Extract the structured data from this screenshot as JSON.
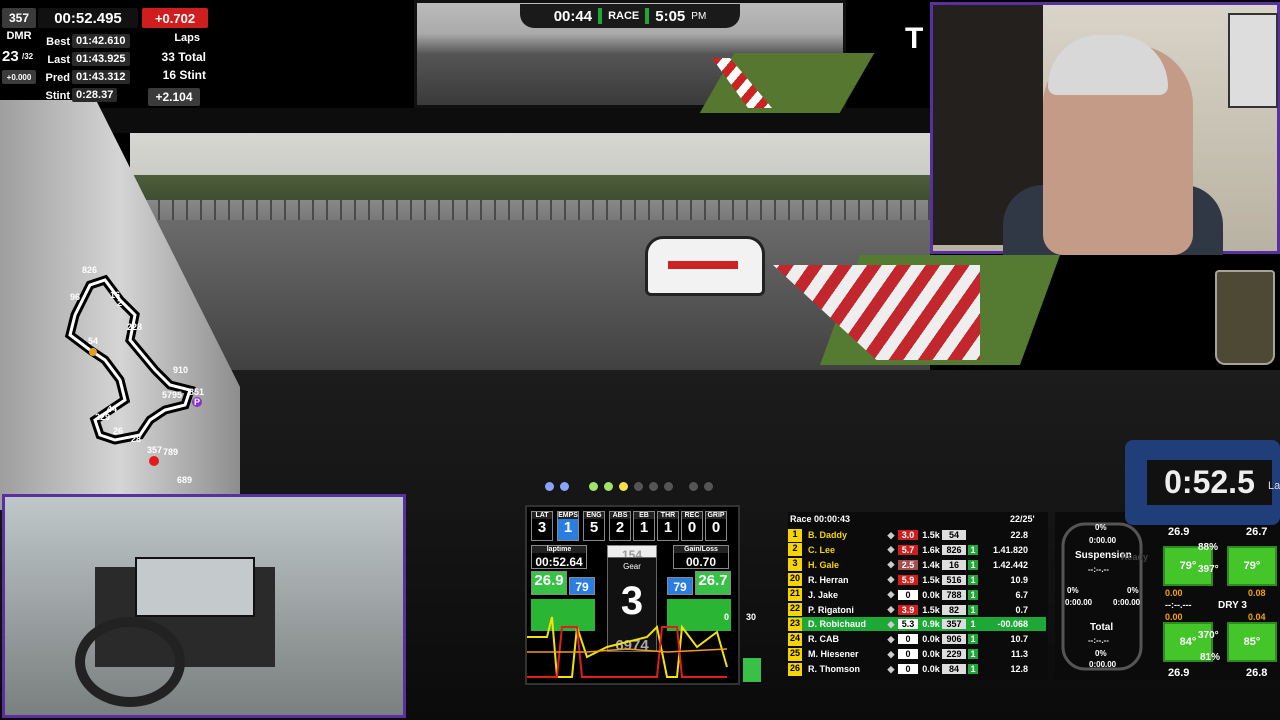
{
  "hud_timing": {
    "incident_count": "357",
    "session_time": "00:52.495",
    "delta": "+0.702",
    "dmr_label": "DMR",
    "position": "23",
    "position_total": "/32",
    "position_delta": "+0.000",
    "best_label": "Best",
    "best_value": "01:42.610",
    "last_label": "Last",
    "last_value": "01:43.925",
    "pred_label": "Pred",
    "pred_value": "01:43.312",
    "stint_label": "Stint",
    "stint_value": "0:28.37",
    "laps_label": "Laps",
    "laps_total": "33 Total",
    "laps_stint": "16 Stint",
    "stint_delta": "+2.104"
  },
  "race_bar": {
    "remaining": "00:44",
    "session": "RACE",
    "clock": "5:05",
    "ampm": "PM"
  },
  "corner_letter": "T",
  "track_map": {
    "labels": [
      "826",
      "96",
      "16",
      "2",
      "228",
      "54",
      "910",
      "851",
      "5795",
      "P",
      "229",
      "44",
      "26",
      "28",
      "357",
      "789",
      "689"
    ],
    "colors": {
      "player": "#e21b1b",
      "pit": "#8b32c9",
      "marker": "#e0a020"
    }
  },
  "dash_display": {
    "cells": [
      {
        "label": "LAT",
        "value": "3"
      },
      {
        "label": "EMPS",
        "value": "1"
      },
      {
        "label": "ENG",
        "value": "5"
      },
      {
        "label": "ABS",
        "value": "2"
      },
      {
        "label": "EB",
        "value": "1"
      },
      {
        "label": "THR",
        "value": "1"
      },
      {
        "label": "REC",
        "value": "0"
      },
      {
        "label": "GRIP",
        "value": "0"
      }
    ],
    "laptime_label": "laptime",
    "laptime": "00:52.64",
    "gain_label": "Gain/Loss",
    "gain": "00.70",
    "speed": "154",
    "gear_label": "Gear",
    "gear": "3",
    "temp_l": "26.9",
    "temp_l2": "79",
    "temp_r": "79",
    "temp_r2": "26.7",
    "rpm": "6974",
    "bar_top_l": "0",
    "bar_top_r": "30"
  },
  "leaderboard": {
    "header": "Race 00:00:43",
    "lap_info": "22/25'",
    "rows": [
      {
        "pos": "1",
        "name": "B. Daddy",
        "ir": "3.0",
        "lic": "1.5k",
        "num": "54",
        "st": "",
        "gap": "22.8",
        "gold": true
      },
      {
        "pos": "2",
        "name": "C. Lee",
        "ir": "5.7",
        "lic": "1.6k",
        "num": "826",
        "st": "1",
        "gap": "1.41.820",
        "gold": true
      },
      {
        "pos": "3",
        "name": "H. Gale",
        "ir": "2.5",
        "lic": "1.4k",
        "num": "16",
        "st": "1",
        "gap": "1.42.442",
        "gold": true
      },
      {
        "pos": "20",
        "name": "R. Herran",
        "ir": "5.9",
        "lic": "1.5k",
        "num": "516",
        "st": "1",
        "gap": "10.9",
        "gold": false
      },
      {
        "pos": "21",
        "name": "J. Jake",
        "ir": "0",
        "lic": "0.0k",
        "num": "788",
        "st": "1",
        "gap": "6.7",
        "gold": false
      },
      {
        "pos": "22",
        "name": "P. Rigatoni",
        "ir": "3.9",
        "lic": "1.5k",
        "num": "82",
        "st": "1",
        "gap": "0.7",
        "gold": false
      },
      {
        "pos": "23",
        "name": "D. Robichaud",
        "ir": "5.3",
        "lic": "0.9k",
        "num": "357",
        "st": "1",
        "gap": "-00.068",
        "gold": false,
        "me": true
      },
      {
        "pos": "24",
        "name": "R. CAB",
        "ir": "0",
        "lic": "0.0k",
        "num": "906",
        "st": "1",
        "gap": "10.7",
        "gold": false
      },
      {
        "pos": "25",
        "name": "M. Hiesener",
        "ir": "0",
        "lic": "0.0k",
        "num": "229",
        "st": "1",
        "gap": "11.3",
        "gold": false
      },
      {
        "pos": "26",
        "name": "R. Thomson",
        "ir": "0",
        "lic": "0.0k",
        "num": "84",
        "st": "1",
        "gap": "12.8",
        "gold": false
      }
    ]
  },
  "tyres": {
    "fl_temp": "26.9",
    "fr_temp": "26.7",
    "fl": "79°",
    "fl_wear": "88%",
    "fl_mid": "397°",
    "fr": "79°",
    "rl": "84°",
    "rl_mid": "370°",
    "rl_wear": "81%",
    "rr": "85°",
    "rl_temp": "26.9",
    "rr_temp": "26.8",
    "susp_label": "Suspension",
    "total_label": "Total",
    "pct_top": "0%",
    "val_top": "0:00.00",
    "dash": "--:--.--",
    "pct_l": "0%",
    "pct_r": "0%",
    "val_l": "0:00.00",
    "val_r": "0:00.00",
    "pct_bottom": "0%",
    "val_bottom": "0:00.00",
    "ready": "Ready",
    "dry_label": "DRY 3",
    "fuel_l": "0.00",
    "fuel_r": "0.08",
    "fuel_l2": "0.00",
    "fuel_r2": "0.04",
    "dry_dash": "--:--.---"
  },
  "clock_display": {
    "value": "0:52.5",
    "label": "Lap"
  }
}
